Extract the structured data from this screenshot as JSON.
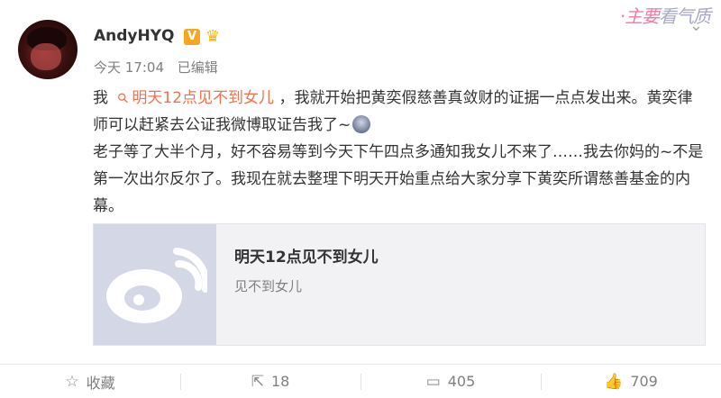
{
  "watermark": {
    "part1": "·主要",
    "part2": "看气质"
  },
  "post": {
    "username": "AndyHYQ",
    "verified_badge": "V",
    "timestamp": "今天 17:04",
    "edited": "已编辑",
    "line1_prefix": "我 ",
    "link_text": "明天12点见不到女儿",
    "line1_suffix": " ，我就开始把黄奕假慈善真敛财的证据一点点发出来。黄奕律师可以赶紧去公证我微博取证告我了~",
    "paragraph2": "老子等了大半个月，好不容易等到今天下午四点多通知我女儿不来了……我去你妈的~不是第一次出尔反尔了。我现在就去整理下明天开始重点给大家分享下黄奕所谓慈善基金的内幕。"
  },
  "card": {
    "title": "明天12点见不到女儿",
    "subtitle": "见不到女儿"
  },
  "footer": {
    "favorite_label": "收藏",
    "repost_count": "18",
    "comment_count": "405",
    "like_count": "709"
  },
  "icons": [
    "more-icon",
    "verified-v-icon",
    "crown-icon",
    "link-icon",
    "emoji-icon",
    "weibo-logo-icon",
    "star-icon",
    "repost-icon",
    "comment-icon",
    "like-icon"
  ]
}
